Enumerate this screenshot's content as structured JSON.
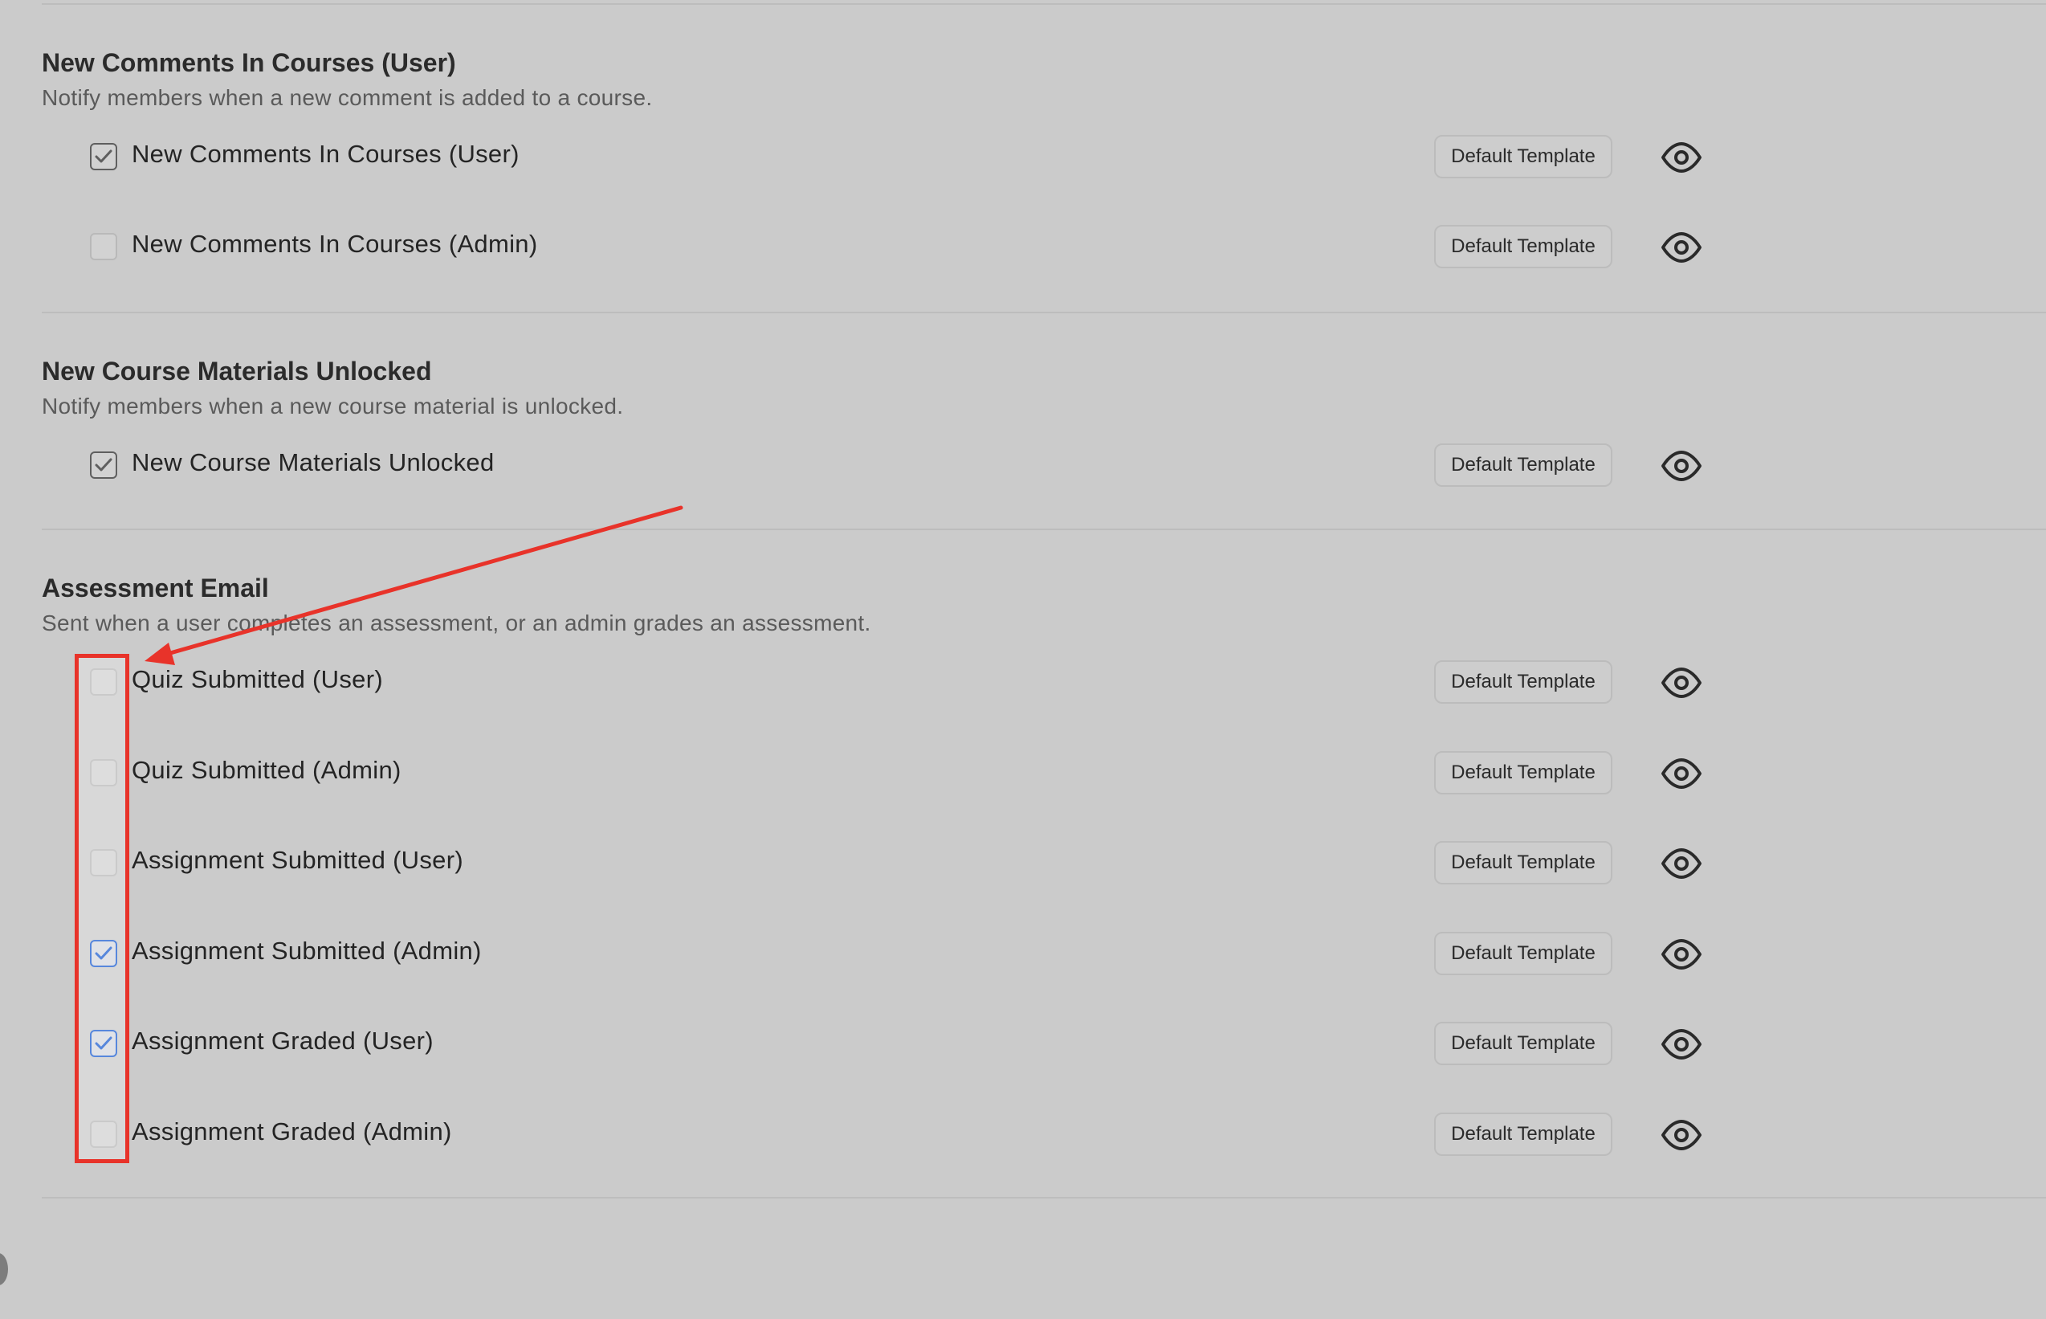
{
  "sections": [
    {
      "title": "New Comments In Courses (User)",
      "description": "Notify members when a new comment is added to a course.",
      "items": [
        {
          "label": "New Comments In Courses (User)",
          "checked": true,
          "check_style": "gray",
          "template_label": "Default Template"
        },
        {
          "label": "New Comments In Courses (Admin)",
          "checked": false,
          "check_style": "none",
          "template_label": "Default Template"
        }
      ]
    },
    {
      "title": "New Course Materials Unlocked",
      "description": "Notify members when a new course material is unlocked.",
      "items": [
        {
          "label": "New Course Materials Unlocked",
          "checked": true,
          "check_style": "gray",
          "template_label": "Default Template"
        }
      ]
    },
    {
      "title": "Assessment Email",
      "description": "Sent when a user completes an assessment, or an admin grades an assessment.",
      "items": [
        {
          "label": "Quiz Submitted (User)",
          "checked": false,
          "check_style": "none",
          "template_label": "Default Template"
        },
        {
          "label": "Quiz Submitted (Admin)",
          "checked": false,
          "check_style": "none",
          "template_label": "Default Template"
        },
        {
          "label": "Assignment Submitted (User)",
          "checked": false,
          "check_style": "none",
          "template_label": "Default Template"
        },
        {
          "label": "Assignment Submitted (Admin)",
          "checked": true,
          "check_style": "blue",
          "template_label": "Default Template"
        },
        {
          "label": "Assignment Graded (User)",
          "checked": true,
          "check_style": "blue",
          "template_label": "Default Template"
        },
        {
          "label": "Assignment Graded (Admin)",
          "checked": false,
          "check_style": "none",
          "template_label": "Default Template"
        }
      ]
    }
  ],
  "colors": {
    "background": "#cbcbcb",
    "annotation_red": "#e8332a",
    "checked_blue": "#1f5fd0",
    "checked_gray": "#5f5f5f"
  },
  "icons": {
    "preview": "eye-icon",
    "check": "check-icon"
  }
}
